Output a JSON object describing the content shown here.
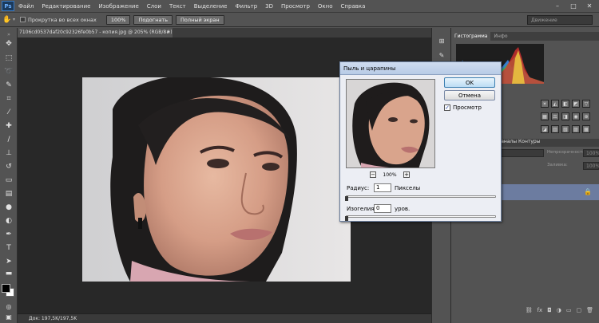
{
  "menubar": {
    "logo": "Ps",
    "items": [
      "Файл",
      "Редактирование",
      "Изображение",
      "Слои",
      "Текст",
      "Выделение",
      "Фильтр",
      "3D",
      "Просмотр",
      "Окно",
      "Справка"
    ]
  },
  "options": {
    "scroll_all_label": "Прокрутка во всех окнах",
    "btn_100": "100%",
    "btn_fit": "Подогнать",
    "btn_fullscreen": "Полный экран",
    "workspace": "Движение"
  },
  "document": {
    "tab_title": "7106cd0537daf20c92326fe0b57 - копия.jpg @ 205% (RGB/8#)",
    "tab_close": "×",
    "status": "Док: 197,5K/197,5K"
  },
  "panels": {
    "histogram_tab": "Гистограмма",
    "info_tab": "Инфо",
    "layers_header": "Каналы Контуры",
    "opacity_label": "Непрозрачность:",
    "opacity_value": "100%",
    "fill_label": "Заливка:",
    "fill_value": "100%"
  },
  "dialog": {
    "title": "Пыль и царапины",
    "ok_label": "OK",
    "cancel_label": "Отмена",
    "preview_label": "Просмотр",
    "preview_checked": true,
    "zoom_value": "100%",
    "zoom_minus": "−",
    "zoom_plus": "+",
    "radius_label": "Радиус:",
    "radius_value": "1",
    "radius_unit": "Пикселы",
    "threshold_label": "Изогелия:",
    "threshold_value": "0",
    "threshold_unit": "уров."
  },
  "colors": {
    "accent": "#3c7fb1",
    "ui_bg": "#535353",
    "canvas_bg": "#282828"
  }
}
